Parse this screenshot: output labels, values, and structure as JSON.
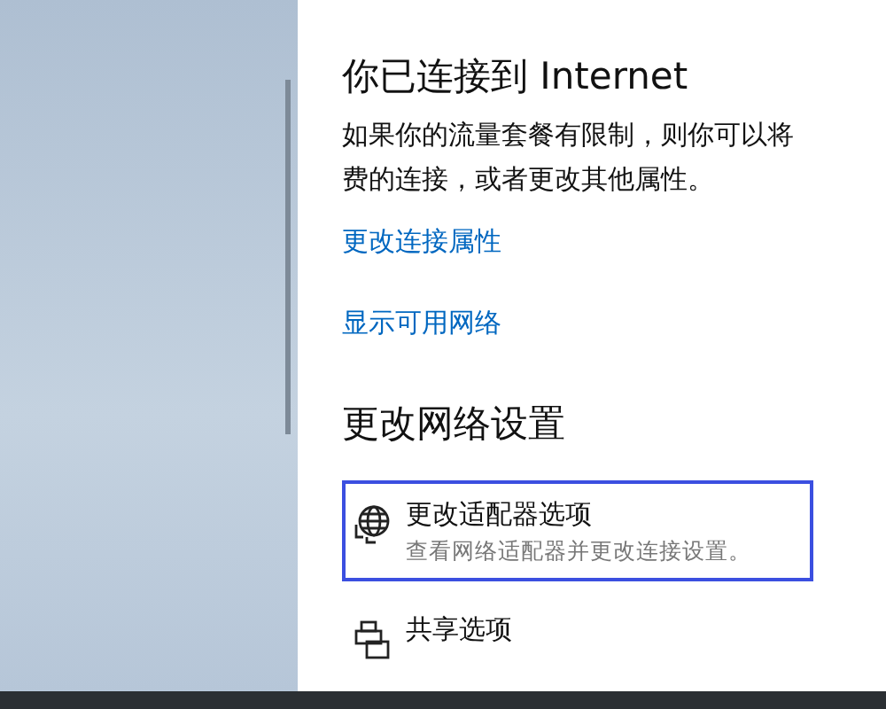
{
  "status": {
    "title": "你已连接到 Internet",
    "lines": [
      "如果你的流量套餐有限制，则你可以将",
      "费的连接，或者更改其他属性。"
    ]
  },
  "links": [
    "更改连接属性",
    "显示可用网络"
  ],
  "section": {
    "title": "更改网络设置",
    "items": [
      {
        "kind": "adapter",
        "title": "更改适配器选项",
        "subtitle": "查看网络适配器并更改连接设置。",
        "selected": true
      },
      {
        "kind": "sharing",
        "title": "共享选项",
        "selected": false
      }
    ]
  }
}
